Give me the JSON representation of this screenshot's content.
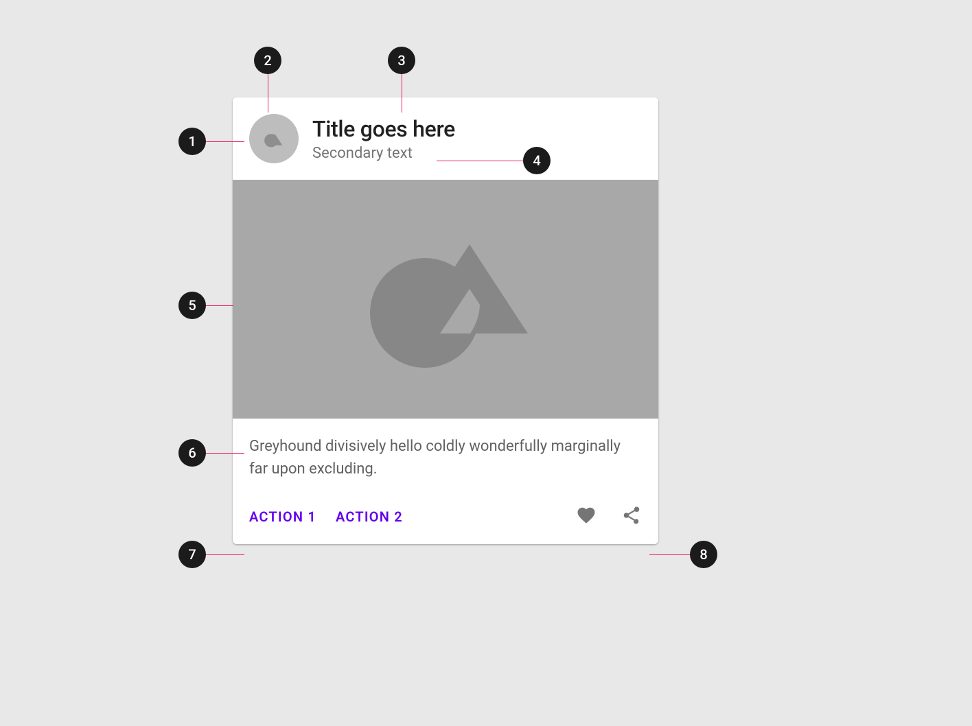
{
  "card": {
    "title": "Title goes here",
    "subtitle": "Secondary text",
    "supporting_text": "Greyhound divisively hello coldly wonderfully marginally far upon excluding.",
    "actions": {
      "action1": "ACTION 1",
      "action2": "ACTION 2"
    },
    "icons": {
      "favorite": "heart-icon",
      "share": "share-icon"
    }
  },
  "annotations": {
    "a1": "1",
    "a2": "2",
    "a3": "3",
    "a4": "4",
    "a5": "5",
    "a6": "6",
    "a7": "7",
    "a8": "8"
  },
  "colors": {
    "accent": "#6200ee",
    "leader": "#e91e63",
    "badge_bg": "#1b1b1b"
  }
}
